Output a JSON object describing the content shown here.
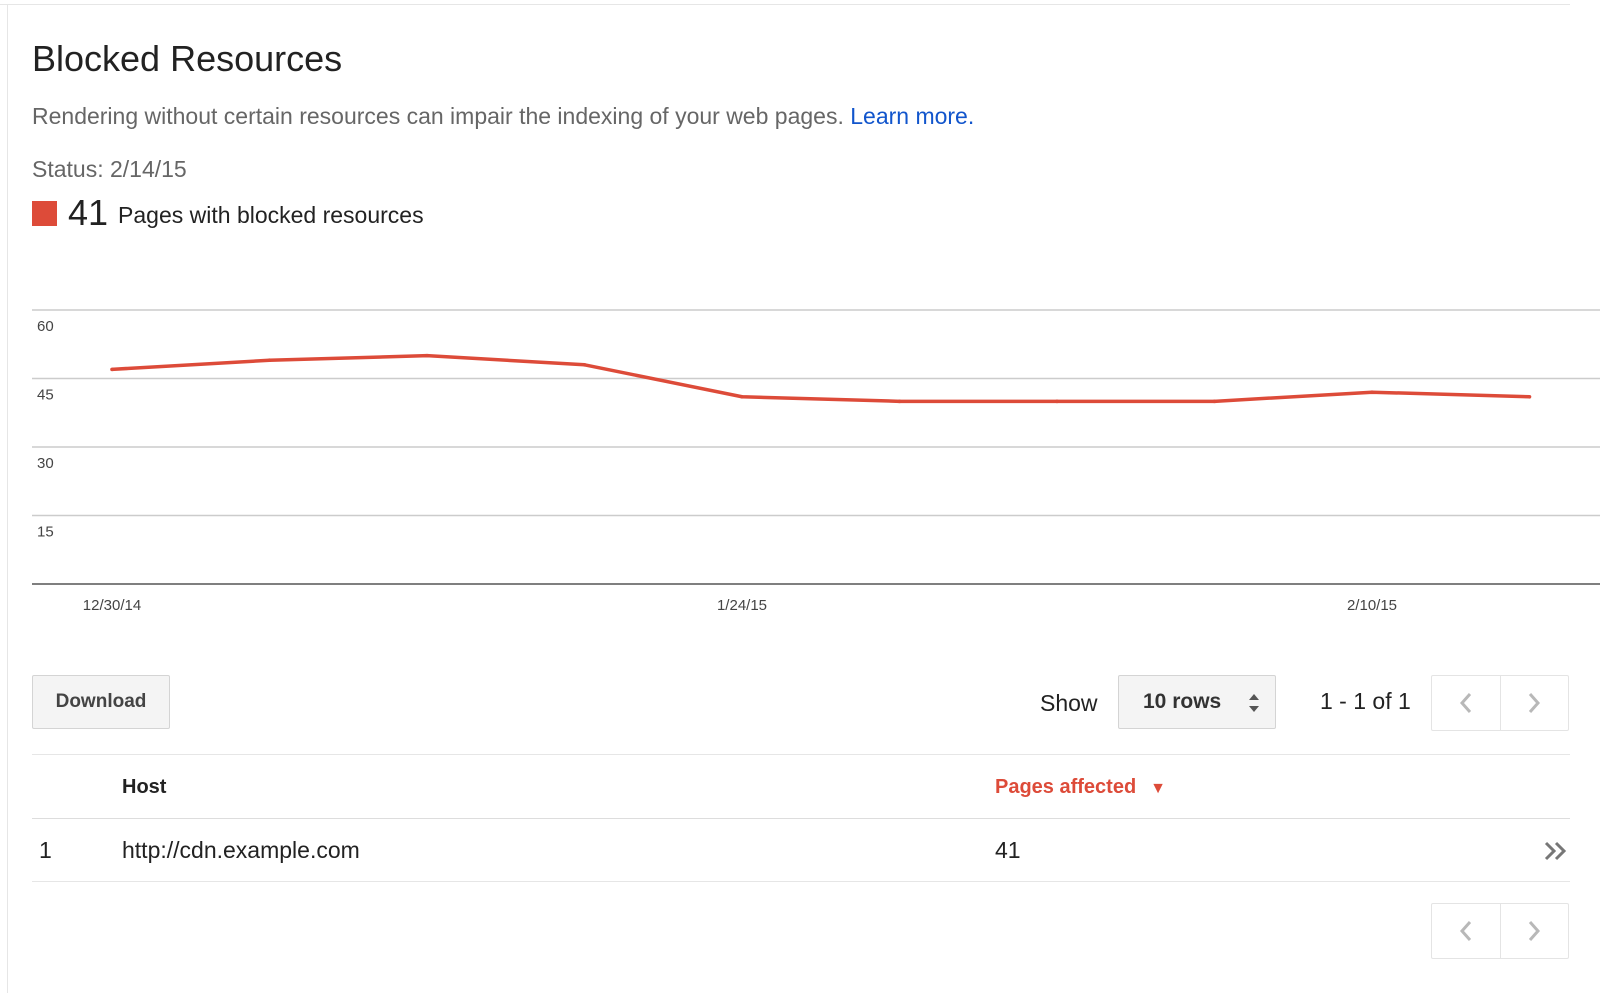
{
  "page": {
    "title": "Blocked Resources",
    "description": "Rendering without certain resources can impair the indexing of your web pages.",
    "learn_more": "Learn more.",
    "status_label": "Status: 2/14/15",
    "summary": {
      "count": "41",
      "label": "Pages with blocked resources"
    }
  },
  "colors": {
    "series": "#dd4b39",
    "link": "#1155cc",
    "sorted_header": "#dd4b39"
  },
  "chart_data": {
    "type": "line",
    "title": "",
    "xlabel": "",
    "ylabel": "",
    "ylim": [
      0,
      60
    ],
    "y_ticks": [
      15,
      30,
      45,
      60
    ],
    "x_tick_labels": [
      "12/30/14",
      "1/24/15",
      "2/10/15"
    ],
    "x_tick_index": [
      0,
      4,
      8
    ],
    "grid": true,
    "series": [
      {
        "name": "Pages with blocked resources",
        "values": [
          47,
          49,
          50,
          48,
          41,
          40,
          40,
          40,
          42,
          41
        ]
      }
    ]
  },
  "toolbar": {
    "download_label": "Download",
    "show_label": "Show",
    "rows_value": "10 rows",
    "page_range": "1 - 1 of 1"
  },
  "table": {
    "columns": {
      "host": "Host",
      "pages_affected": "Pages affected"
    },
    "rows": [
      {
        "index": "1",
        "host": "http://cdn.example.com",
        "pages_affected": "41"
      }
    ]
  },
  "icons": {
    "legend": "legend-swatch",
    "rows": "sort-updown-icon",
    "prev": "chevron-left-icon",
    "next": "chevron-right-icon",
    "sort": "sort-down-icon",
    "row_detail": "double-chevron-right-icon"
  }
}
